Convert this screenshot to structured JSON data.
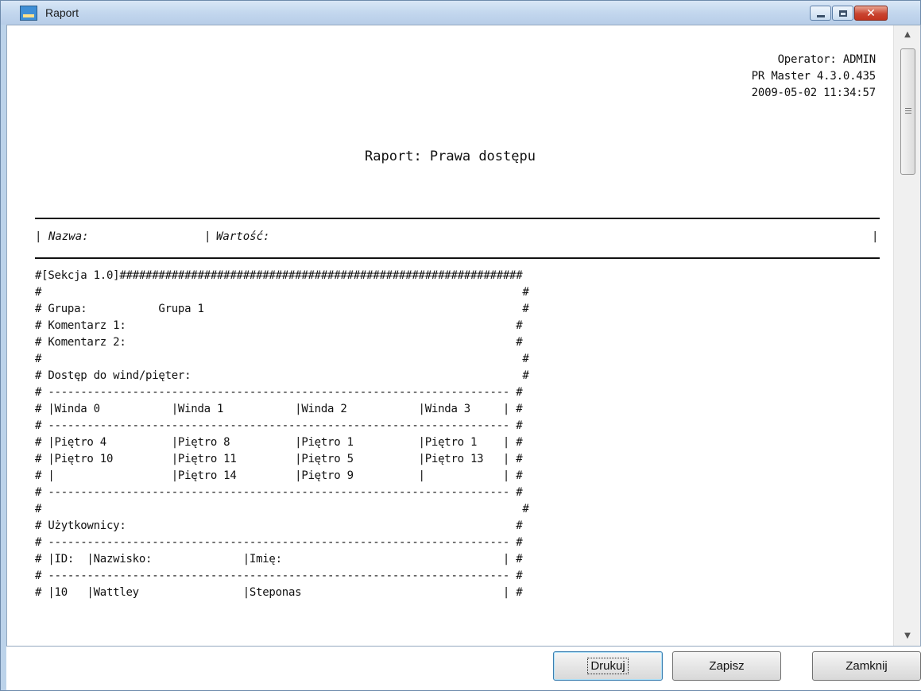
{
  "window": {
    "title": "Raport"
  },
  "report": {
    "operator": "Operator: ADMIN",
    "version": "PR Master 4.3.0.435",
    "timestamp": "2009-05-02 11:34:57",
    "title": "Raport: Prawa dostępu",
    "header": {
      "pipe1": "|",
      "name_label": "Nazwa:",
      "pipe2": "|",
      "value_label": "Wartość:",
      "pipe3": "|"
    },
    "section_lines": [
      "#[Sekcja 1.0]##############################################################",
      "#                                                                          #",
      "# Grupa:           Grupa 1                                                 #",
      "# Komentarz 1:                                                            #",
      "# Komentarz 2:                                                            #",
      "#                                                                          #",
      "# Dostęp do wind/pięter:                                                   #",
      "# ----------------------------------------------------------------------- #",
      "# |Winda 0           |Winda 1           |Winda 2           |Winda 3     | #",
      "# ----------------------------------------------------------------------- #",
      "# |Piętro 4          |Piętro 8          |Piętro 1          |Piętro 1    | #",
      "# |Piętro 10         |Piętro 11         |Piętro 5          |Piętro 13   | #",
      "# |                  |Piętro 14         |Piętro 9          |            | #",
      "# ----------------------------------------------------------------------- #",
      "#                                                                          #",
      "# Użytkownicy:                                                            #",
      "# ----------------------------------------------------------------------- #",
      "# |ID:  |Nazwisko:              |Imię:                                  | #",
      "# ----------------------------------------------------------------------- #",
      "# |10   |Wattley                |Steponas                               | #"
    ]
  },
  "buttons": {
    "print": "Drukuj",
    "save": "Zapisz",
    "close": "Zamknij"
  }
}
